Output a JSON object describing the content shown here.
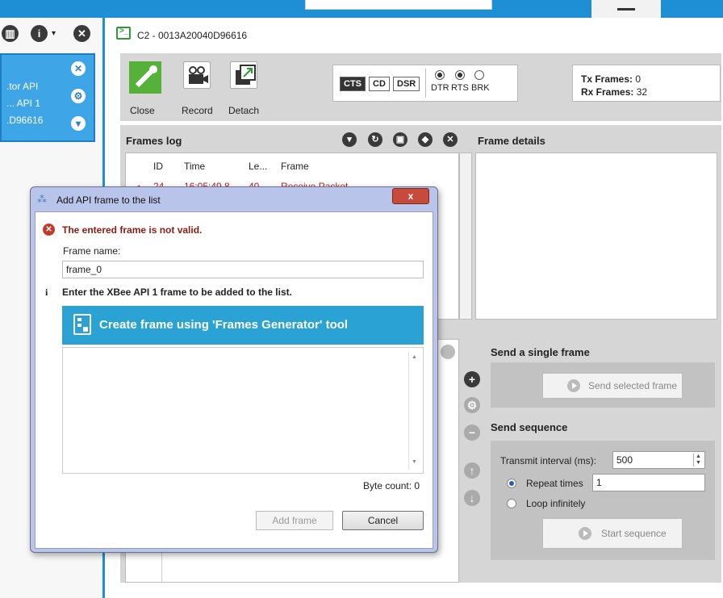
{
  "left_panel": {
    "toolbar_icons": [
      "book-icon",
      "info-icon",
      "close-icon"
    ],
    "device": {
      "line1": ".tor API",
      "line2": "... API 1",
      "line3": ".D96616"
    }
  },
  "console": {
    "title": "C2 - 0013A20040D96616"
  },
  "toolbar": {
    "close_label": "Close",
    "record_label": "Record",
    "detach_label": "Detach",
    "signals": [
      "CTS",
      "CD",
      "DSR"
    ],
    "lines": [
      "DTR",
      "RTS",
      "BRK"
    ],
    "tx_label": "Tx Frames:",
    "tx_value": "0",
    "rx_label": "Rx Frames:",
    "rx_value": "32"
  },
  "frames_log": {
    "title": "Frames log",
    "columns": [
      "ID",
      "Time",
      "Le...",
      "Frame"
    ],
    "row": {
      "id": "24",
      "time": "16:05:49.8",
      "len": "40",
      "frame": "Receive Packet"
    }
  },
  "frame_details": {
    "title": "Frame details"
  },
  "send_single": {
    "title": "Send a single frame",
    "button": "Send selected frame"
  },
  "send_sequence": {
    "title": "Send sequence",
    "interval_label": "Transmit interval (ms):",
    "interval_value": "500",
    "repeat_label": "Repeat times",
    "repeat_value": "1",
    "loop_label": "Loop infinitely",
    "button": "Start sequence"
  },
  "dialog": {
    "title": "Add API frame to the list",
    "close_glyph": "x",
    "error": "The entered frame is not valid.",
    "name_label": "Frame name:",
    "name_value": "frame_0",
    "info": "Enter the XBee API 1 frame to be added to the list.",
    "generator_label": "Create frame using 'Frames Generator' tool",
    "byte_count": "Byte count: 0",
    "add_button": "Add frame",
    "cancel_button": "Cancel"
  }
}
